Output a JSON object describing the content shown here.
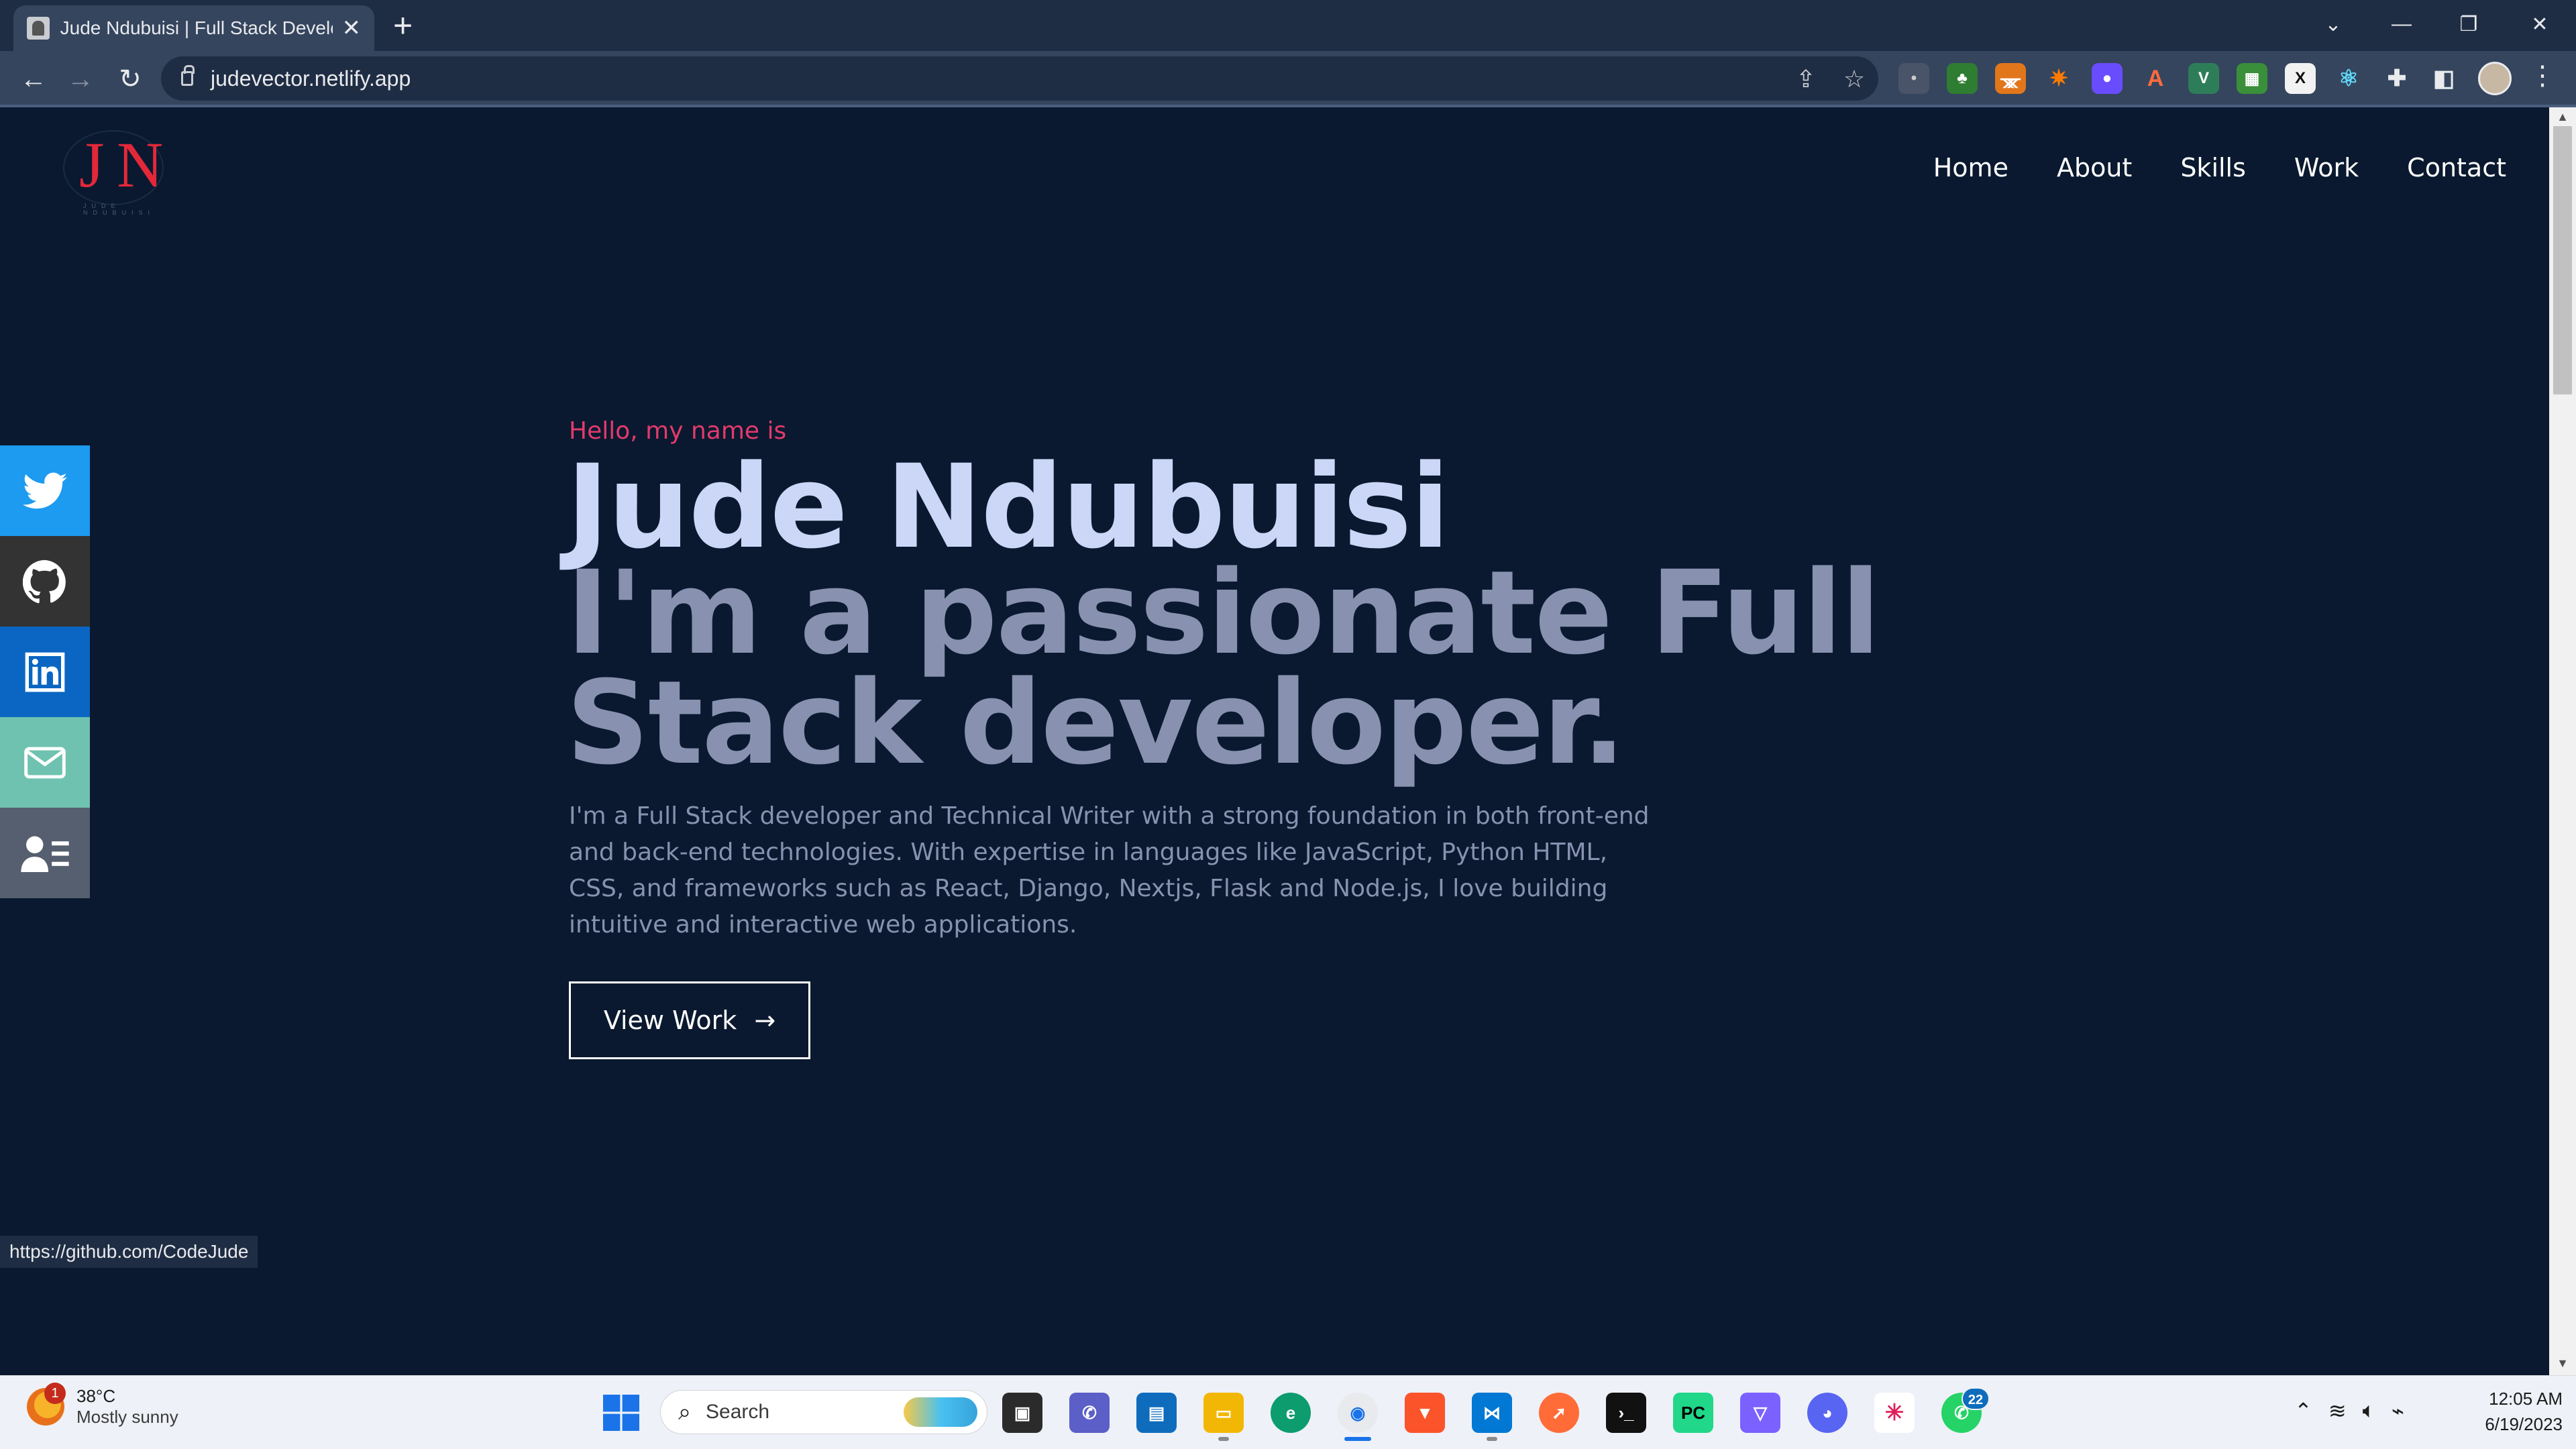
{
  "browser": {
    "tab_title": "Jude Ndubuisi | Full Stack Developer",
    "url": "judevector.netlify.app",
    "status_url": "https://github.com/CodeJude"
  },
  "logo": {
    "letter1": "J",
    "letter2": "N",
    "subtitle": "JUDE NDUBUISI"
  },
  "nav": {
    "home": "Home",
    "about": "About",
    "skills": "Skills",
    "work": "Work",
    "contact": "Contact"
  },
  "hero": {
    "greeting": "Hello, my name is",
    "name": "Jude Ndubuisi",
    "tagline": "I'm a passionate Full Stack developer.",
    "bio": "I'm a Full Stack developer and Technical Writer with a strong foundation in both front-end and back-end technologies. With expertise in languages like JavaScript, Python HTML, CSS, and frameworks such as React, Django, Nextjs, Flask and Node.js, I love building intuitive and interactive web applications.",
    "cta_label": "View Work"
  },
  "social": [
    {
      "name": "twitter-icon",
      "color": "#1d9bf0"
    },
    {
      "name": "github-icon",
      "color": "#333333"
    },
    {
      "name": "linkedin-icon",
      "color": "#0a66c2"
    },
    {
      "name": "mail-icon",
      "color": "#6fc2b0"
    },
    {
      "name": "resume-icon",
      "color": "#565f6f"
    }
  ],
  "taskbar": {
    "weather_temp": "38°C",
    "weather_desc": "Mostly sunny",
    "weather_badge": "1",
    "search_label": "Search",
    "whatsapp_badge": "22",
    "time": "12:05 AM",
    "date": "6/19/2023"
  },
  "colors": {
    "page_bg": "#0a192f",
    "accent": "#e23a6d",
    "name": "#ccd6f6",
    "muted": "#8892b0"
  }
}
